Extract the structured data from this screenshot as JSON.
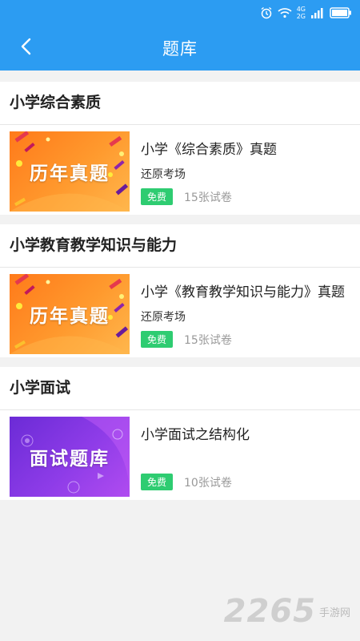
{
  "statusbar": {
    "network_labels": [
      "4G",
      "2G"
    ],
    "icons": [
      "alarm-icon",
      "wifi-icon",
      "signal-icon",
      "battery-icon"
    ]
  },
  "header": {
    "title": "题库",
    "back_icon": "chevron-left-icon"
  },
  "sections": [
    {
      "title": "小学综合素质",
      "items": [
        {
          "thumb_text": "历年真题",
          "title": "小学《综合素质》真题",
          "subtitle": "还原考场",
          "badge": "免费",
          "count": "15张试卷"
        }
      ]
    },
    {
      "title": "小学教育教学知识与能力",
      "items": [
        {
          "thumb_text": "历年真题",
          "title": "小学《教育教学知识与能力》真题",
          "subtitle": "还原考场",
          "badge": "免费",
          "count": "15张试卷"
        }
      ]
    },
    {
      "title": "小学面试",
      "items": [
        {
          "thumb_text": "面试题库",
          "title": "小学面试之结构化",
          "subtitle": "",
          "badge": "免费",
          "count": "10张试卷"
        }
      ]
    }
  ],
  "watermark": {
    "number": "2265",
    "text": "手游网"
  },
  "colors": {
    "header_bg": "#2c9cf2",
    "badge_bg": "#2ecc71",
    "orange_thumb": "#ff8a22",
    "purple_thumb": "#7b33e0"
  }
}
